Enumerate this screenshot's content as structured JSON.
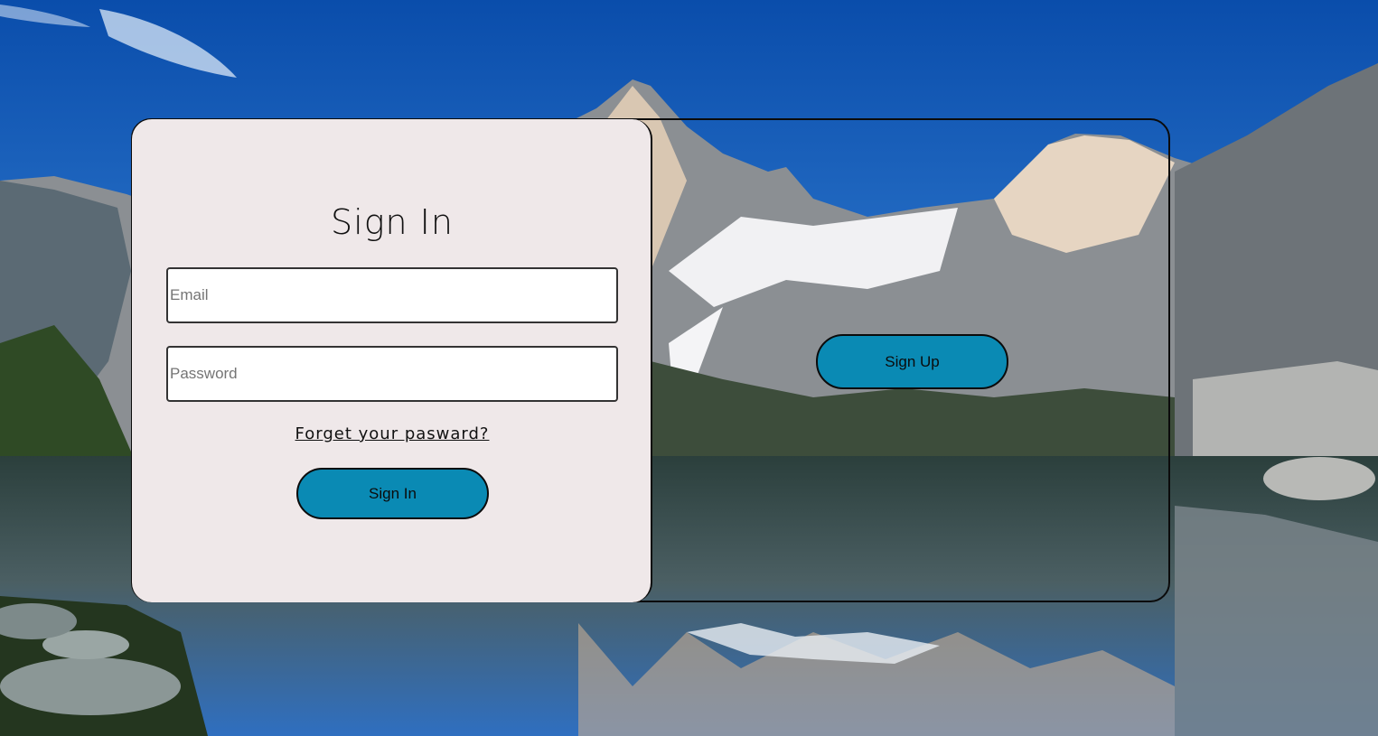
{
  "signin": {
    "title": "Sign In",
    "email_placeholder": "Email",
    "password_placeholder": "Password",
    "forgot_link": "Forget your pasward?",
    "button_label": "Sign In"
  },
  "signup": {
    "button_label": "Sign Up"
  },
  "colors": {
    "panel_bg": "#efe8e9",
    "button_bg": "#0a8ab4",
    "border": "#0b0b0b"
  }
}
